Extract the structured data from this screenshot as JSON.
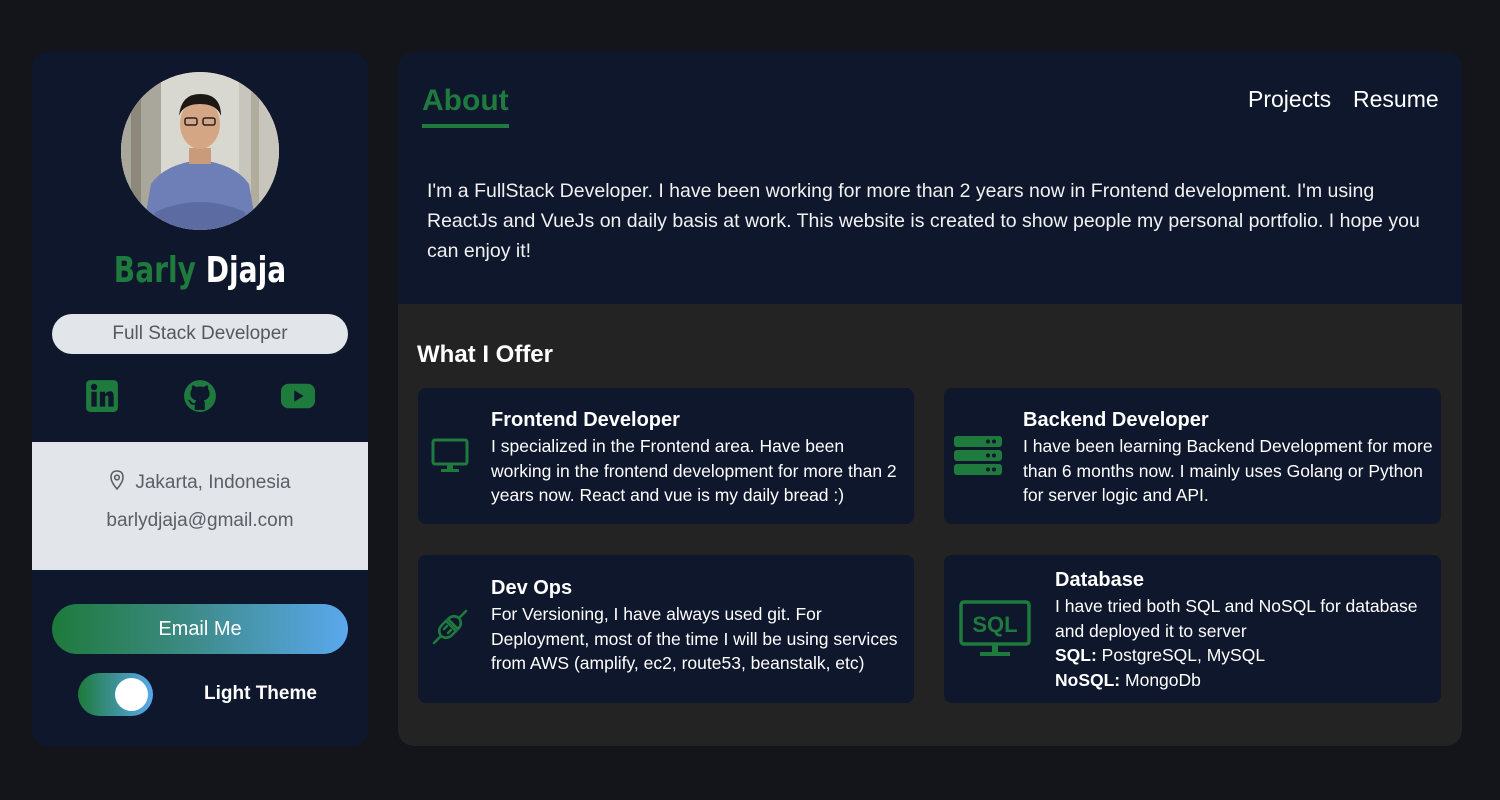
{
  "profile": {
    "first_name": "Barly",
    "last_name": "Djaja",
    "role": "Full Stack Developer",
    "location": "Jakarta, Indonesia",
    "email": "barlydjaja@gmail.com",
    "email_button": "Email Me",
    "theme_label": "Light Theme",
    "theme_toggle_on": true,
    "socials": [
      "linkedin-icon",
      "github-icon",
      "youtube-icon"
    ]
  },
  "nav": {
    "active_tab": "About",
    "links": [
      "Projects",
      "Resume"
    ]
  },
  "about": {
    "text": "I'm a FullStack Developer. I have been working for more than 2 years now in Frontend development. I'm using ReactJs and VueJs on daily basis at work. This website is created to show people my personal portfolio. I hope you can enjoy it!"
  },
  "offer": {
    "title": "What I Offer",
    "cards": [
      {
        "title": "Frontend Developer",
        "icon": "monitor-icon",
        "desc": "I specialized in the Frontend area. Have been working in the frontend development for more than 2 years now. React and vue is my daily bread :)"
      },
      {
        "title": "Backend Developer",
        "icon": "server-icon",
        "desc": "I have been learning Backend Development for more than 6 months now. I mainly uses Golang or Python for server logic and API."
      },
      {
        "title": "Dev Ops",
        "icon": "plug-icon",
        "desc": "For Versioning, I have always used git. For Deployment, most of the time I will be using services from AWS (amplify, ec2, route53, beanstalk, etc)"
      },
      {
        "title": "Database",
        "icon": "sql-monitor-icon",
        "desc": "I have tried both SQL and NoSQL for database and deployed it to server",
        "sql_label": "SQL:",
        "sql_value": " PostgreSQL, MySQL",
        "nosql_label": "NoSQL:",
        "nosql_value": " MongoDb"
      }
    ]
  },
  "colors": {
    "accent_green": "#1f7a3e",
    "panel": "#0e172c",
    "background": "#13151b",
    "lower_panel": "#232323",
    "pill": "#e2e5ea",
    "gradient_end": "#5aa8ee"
  }
}
